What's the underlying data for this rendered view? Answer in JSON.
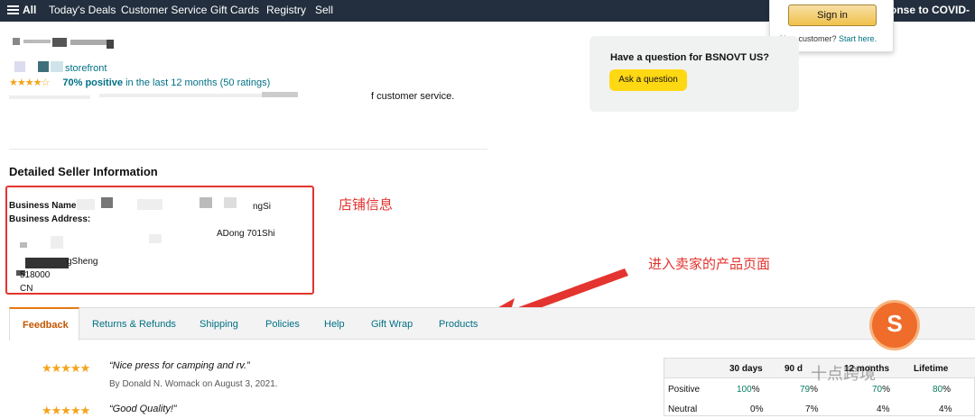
{
  "nav": {
    "all": "All",
    "links": [
      "Today's Deals",
      "Customer Service",
      "Gift Cards",
      "Registry",
      "Sell"
    ],
    "right_text": "esponse to COVID-"
  },
  "signin": {
    "button": "Sign in",
    "new_customer": "New customer?",
    "start_here": "Start here."
  },
  "seller": {
    "storefront": "storefront",
    "stars": "★★★★☆",
    "positive": "70% positive",
    "period": "in the last 12 months (50 ratings)",
    "service_text": "f customer service."
  },
  "question": {
    "text": "Have a question for BSNOVT US?",
    "button": "Ask a question"
  },
  "detail": {
    "title": "Detailed Seller Information",
    "business_name_label": "Business Name",
    "business_name_tail": "ngSi",
    "business_address_label": "Business Address:",
    "line_adong": "ADong 701Shi",
    "line_sheng": "gSheng",
    "postcode": "518000",
    "country": "CN"
  },
  "annotations": {
    "store_info": "店铺信息",
    "seller_products": "进入卖家的产品页面"
  },
  "tabs": [
    "Feedback",
    "Returns & Refunds",
    "Shipping",
    "Policies",
    "Help",
    "Gift Wrap",
    "Products"
  ],
  "reviews": [
    {
      "stars": "★★★★★",
      "quote": "“Nice press for camping and rv.”",
      "by": "By Donald N. Womack on August 3, 2021."
    },
    {
      "stars": "★★★★★",
      "quote": "“Good Quality!”"
    }
  ],
  "stats": {
    "headers": [
      "30 days",
      "90 d",
      "12 months",
      "Lifetime"
    ],
    "rows": [
      {
        "label": "Positive",
        "values": [
          "100",
          "79",
          "70",
          "80"
        ]
      },
      {
        "label": "Neutral",
        "values": [
          "0",
          "7",
          "4",
          "4"
        ]
      }
    ]
  },
  "watermark": "十点跨境",
  "logo": {
    "glyph": "S"
  }
}
